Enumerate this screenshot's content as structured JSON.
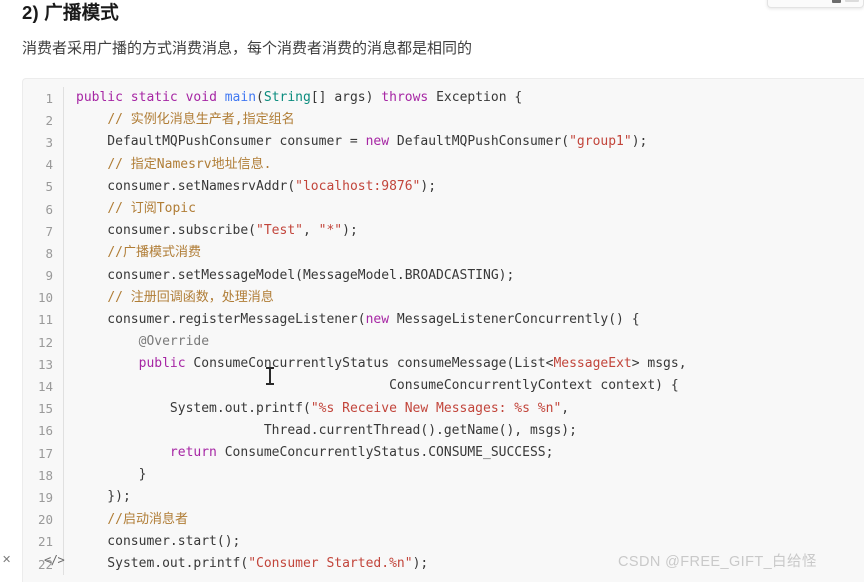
{
  "page": {
    "heading": "2) 广播模式",
    "paragraph": "消费者采用广播的方式消费消息，每个消费者消费的消息都是相同的",
    "watermark": "CSDN @FREE_GIFT_白给怪"
  },
  "icons": {
    "code_icon": "</>",
    "close_icon": "✕",
    "cursor": "i-beam-text-cursor"
  },
  "colors": {
    "keyword": "#a626a4",
    "type": "#0b8c7e",
    "function": "#4078f2",
    "string": "#c2453b",
    "comment": "#b07d36",
    "annotation": "#7a7a7a",
    "plain": "#383838",
    "code_background": "#f8f8f8",
    "gutter_text": "#9a9a9a",
    "page_background": "#ffffff"
  },
  "code_block": {
    "language": "java",
    "line_numbers": [
      "1",
      "2",
      "3",
      "4",
      "5",
      "6",
      "7",
      "8",
      "9",
      "10",
      "11",
      "12",
      "13",
      "14",
      "15",
      "16",
      "17",
      "18",
      "19",
      "20",
      "21",
      "22"
    ],
    "lines": [
      {
        "n": "1",
        "text": "public static void main(String[] args) throws Exception {",
        "tokens": [
          {
            "t": "public",
            "c": "kw"
          },
          {
            "t": " ",
            "c": "pln"
          },
          {
            "t": "static",
            "c": "kw"
          },
          {
            "t": " ",
            "c": "pln"
          },
          {
            "t": "void",
            "c": "kw"
          },
          {
            "t": " ",
            "c": "pln"
          },
          {
            "t": "main",
            "c": "fn"
          },
          {
            "t": "(",
            "c": "pln"
          },
          {
            "t": "String",
            "c": "typ"
          },
          {
            "t": "[] args) ",
            "c": "pln"
          },
          {
            "t": "throws",
            "c": "kw"
          },
          {
            "t": " Exception {",
            "c": "pln"
          }
        ]
      },
      {
        "n": "2",
        "text": "    // 实例化消息生产者,指定组名",
        "tokens": [
          {
            "t": "    ",
            "c": "pln"
          },
          {
            "t": "// 实例化消息生产者,指定组名",
            "c": "cmt"
          }
        ]
      },
      {
        "n": "3",
        "text": "    DefaultMQPushConsumer consumer = new DefaultMQPushConsumer(\"group1\");",
        "tokens": [
          {
            "t": "    DefaultMQPushConsumer consumer = ",
            "c": "pln"
          },
          {
            "t": "new",
            "c": "kw"
          },
          {
            "t": " DefaultMQPushConsumer(",
            "c": "pln"
          },
          {
            "t": "\"group1\"",
            "c": "str"
          },
          {
            "t": ");",
            "c": "pln"
          }
        ]
      },
      {
        "n": "4",
        "text": "    // 指定Namesrv地址信息.",
        "tokens": [
          {
            "t": "    ",
            "c": "pln"
          },
          {
            "t": "// 指定Namesrv地址信息.",
            "c": "cmt"
          }
        ]
      },
      {
        "n": "5",
        "text": "    consumer.setNamesrvAddr(\"localhost:9876\");",
        "tokens": [
          {
            "t": "    consumer.setNamesrvAddr(",
            "c": "pln"
          },
          {
            "t": "\"localhost:9876\"",
            "c": "str"
          },
          {
            "t": ");",
            "c": "pln"
          }
        ]
      },
      {
        "n": "6",
        "text": "    // 订阅Topic",
        "tokens": [
          {
            "t": "    ",
            "c": "pln"
          },
          {
            "t": "// 订阅Topic",
            "c": "cmt"
          }
        ]
      },
      {
        "n": "7",
        "text": "    consumer.subscribe(\"Test\", \"*\");",
        "tokens": [
          {
            "t": "    consumer.subscribe(",
            "c": "pln"
          },
          {
            "t": "\"Test\"",
            "c": "str"
          },
          {
            "t": ", ",
            "c": "pln"
          },
          {
            "t": "\"*\"",
            "c": "str"
          },
          {
            "t": ");",
            "c": "pln"
          }
        ]
      },
      {
        "n": "8",
        "text": "    //广播模式消费",
        "tokens": [
          {
            "t": "    ",
            "c": "pln"
          },
          {
            "t": "//广播模式消费",
            "c": "cmt"
          }
        ]
      },
      {
        "n": "9",
        "text": "    consumer.setMessageModel(MessageModel.BROADCASTING);",
        "tokens": [
          {
            "t": "    consumer.setMessageModel(MessageModel.BROADCASTING);",
            "c": "pln"
          }
        ]
      },
      {
        "n": "10",
        "text": "    // 注册回调函数，处理消息",
        "tokens": [
          {
            "t": "    ",
            "c": "pln"
          },
          {
            "t": "// 注册回调函数，处理消息",
            "c": "cmt"
          }
        ]
      },
      {
        "n": "11",
        "text": "    consumer.registerMessageListener(new MessageListenerConcurrently() {",
        "tokens": [
          {
            "t": "    consumer.registerMessageListener(",
            "c": "pln"
          },
          {
            "t": "new",
            "c": "kw"
          },
          {
            "t": " MessageListenerConcurrently() {",
            "c": "pln"
          }
        ]
      },
      {
        "n": "12",
        "text": "        @Override",
        "tokens": [
          {
            "t": "        ",
            "c": "pln"
          },
          {
            "t": "@Override",
            "c": "ann"
          }
        ]
      },
      {
        "n": "13",
        "text": "        public ConsumeConcurrentlyStatus consumeMessage(List<MessageExt> msgs,",
        "tokens": [
          {
            "t": "        ",
            "c": "pln"
          },
          {
            "t": "public",
            "c": "kw"
          },
          {
            "t": " ConsumeConcurrentlyStatus consumeMessage(List<",
            "c": "pln"
          },
          {
            "t": "MessageExt",
            "c": "gen"
          },
          {
            "t": "> msgs,",
            "c": "pln"
          }
        ]
      },
      {
        "n": "14",
        "text": "                                        ConsumeConcurrentlyContext context) {",
        "tokens": [
          {
            "t": "                                        ConsumeConcurrentlyContext context) {",
            "c": "pln"
          }
        ]
      },
      {
        "n": "15",
        "text": "            System.out.printf(\"%s Receive New Messages: %s %n\",",
        "tokens": [
          {
            "t": "            System.out.printf(",
            "c": "pln"
          },
          {
            "t": "\"%s Receive New Messages: %s %n\"",
            "c": "str"
          },
          {
            "t": ",",
            "c": "pln"
          }
        ]
      },
      {
        "n": "16",
        "text": "                        Thread.currentThread().getName(), msgs);",
        "tokens": [
          {
            "t": "                        Thread.currentThread().getName(), msgs);",
            "c": "pln"
          }
        ]
      },
      {
        "n": "17",
        "text": "            return ConsumeConcurrentlyStatus.CONSUME_SUCCESS;",
        "tokens": [
          {
            "t": "            ",
            "c": "pln"
          },
          {
            "t": "return",
            "c": "kw"
          },
          {
            "t": " ConsumeConcurrentlyStatus.CONSUME_SUCCESS;",
            "c": "pln"
          }
        ]
      },
      {
        "n": "18",
        "text": "        }",
        "tokens": [
          {
            "t": "        }",
            "c": "pln"
          }
        ]
      },
      {
        "n": "19",
        "text": "    });",
        "tokens": [
          {
            "t": "    });",
            "c": "pln"
          }
        ]
      },
      {
        "n": "20",
        "text": "    //启动消息者",
        "tokens": [
          {
            "t": "    ",
            "c": "pln"
          },
          {
            "t": "//启动消息者",
            "c": "cmt"
          }
        ]
      },
      {
        "n": "21",
        "text": "    consumer.start();",
        "tokens": [
          {
            "t": "    consumer.start();",
            "c": "pln"
          }
        ]
      },
      {
        "n": "22",
        "text": "    System.out.printf(\"Consumer Started.%n\");",
        "tokens": [
          {
            "t": "    System.out.printf(",
            "c": "pln"
          },
          {
            "t": "\"Consumer Started.%n\"",
            "c": "str"
          },
          {
            "t": ");",
            "c": "pln"
          }
        ]
      }
    ]
  }
}
